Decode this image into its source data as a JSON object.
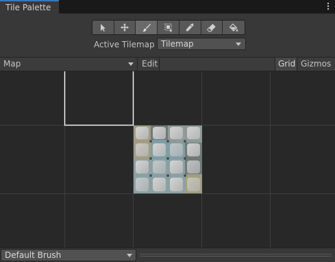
{
  "window": {
    "tab_title": "Tile Palette",
    "menu_icon": "kebab-menu-icon"
  },
  "toolbar": {
    "tools": [
      {
        "name": "select-tool",
        "icon": "arrow-cursor-icon",
        "active": false
      },
      {
        "name": "move-tool",
        "icon": "move-arrows-icon",
        "active": false
      },
      {
        "name": "paint-tool",
        "icon": "brush-icon",
        "active": true
      },
      {
        "name": "box-fill-tool",
        "icon": "box-fill-icon",
        "active": false
      },
      {
        "name": "picker-tool",
        "icon": "eyedropper-icon",
        "active": false
      },
      {
        "name": "erase-tool",
        "icon": "eraser-icon",
        "active": false
      },
      {
        "name": "fill-tool",
        "icon": "paint-bucket-icon",
        "active": false
      }
    ]
  },
  "active_tilemap": {
    "label": "Active Tilemap",
    "value": "Tilemap"
  },
  "palette_bar": {
    "palette_value": "Map",
    "edit_label": "Edit",
    "grid_label": "Grid",
    "gizmos_label": "Gizmos"
  },
  "bottom": {
    "brush_value": "Default Brush"
  },
  "colors": {
    "accent": "#3a79bb",
    "background": "#282828",
    "panel": "#383838",
    "grid_line": "#3d3d3d",
    "selection": "#ffffff"
  }
}
